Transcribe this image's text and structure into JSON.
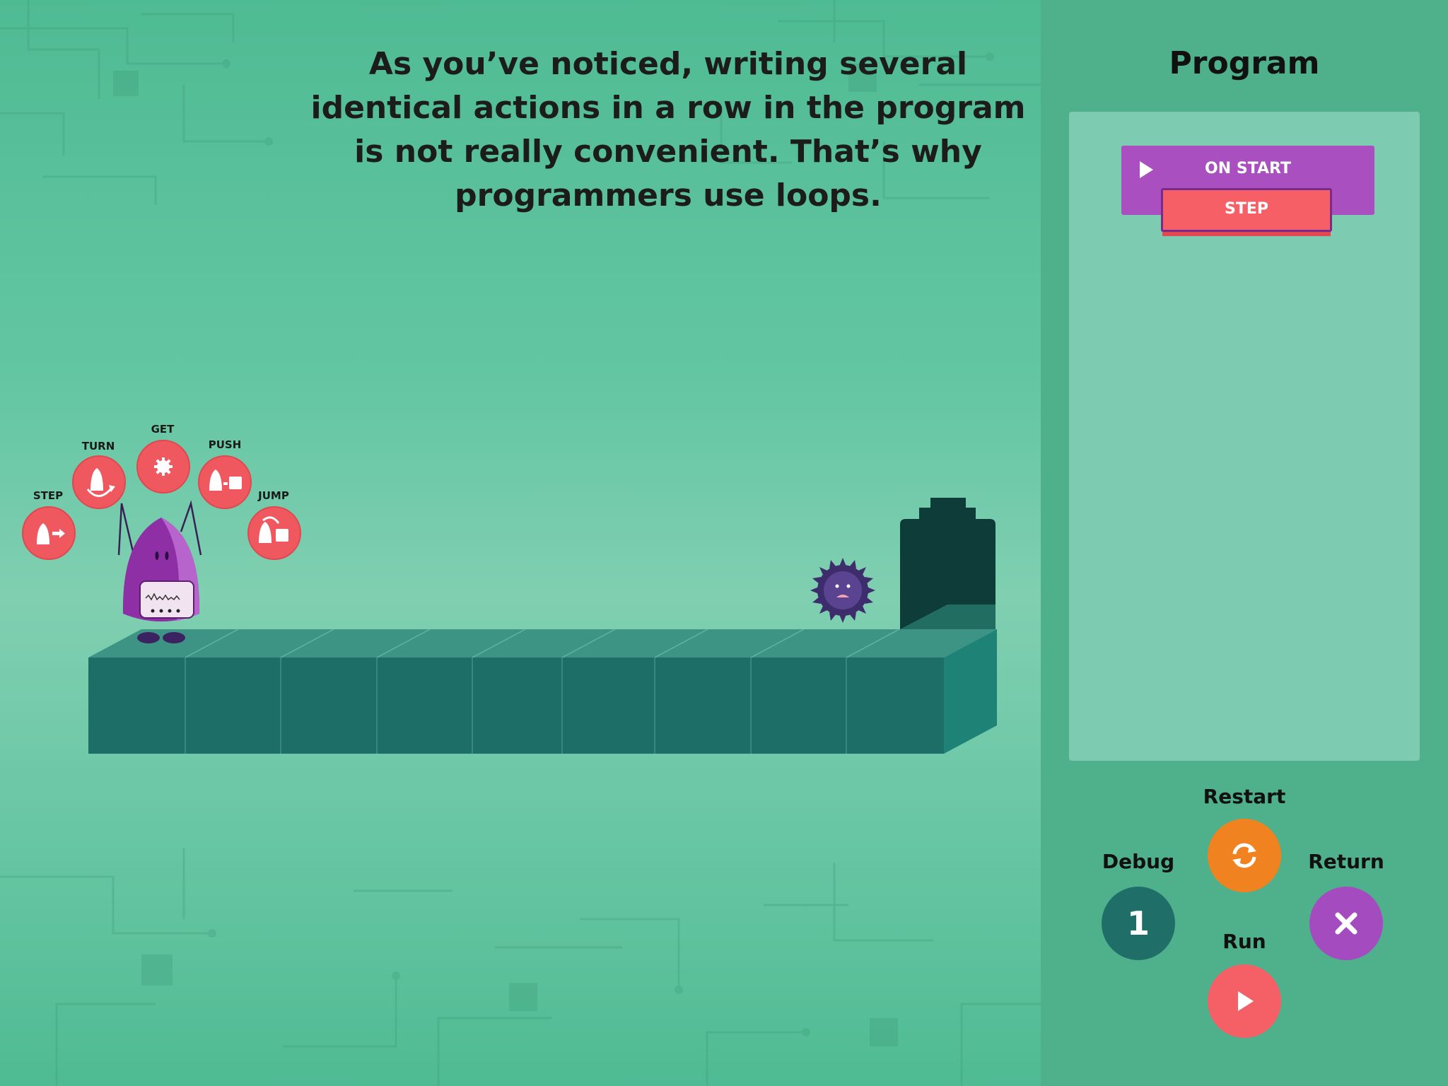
{
  "instruction": "As you’ve noticed, writing several identical actions in a row in the program is not really convenient. That’s why programmers use loops.",
  "actions": [
    {
      "label": "STEP",
      "icon": "robot-step-icon"
    },
    {
      "label": "TURN",
      "icon": "robot-turn-icon"
    },
    {
      "label": "GET",
      "icon": "gear-icon"
    },
    {
      "label": "PUSH",
      "icon": "robot-push-icon"
    },
    {
      "label": "JUMP",
      "icon": "robot-jump-icon"
    }
  ],
  "colors": {
    "stage_bg": "#63c6a3",
    "panel_bg": "#4fb08c",
    "action_red": "#f0585f",
    "block_purple": "#a94fbf",
    "block_red": "#f75f66",
    "tile_front": "#1d6e66",
    "tile_top": "#3d9484",
    "restart_orange": "#f0821f",
    "debug_teal": "#1f6e68",
    "return_purple": "#a34bbf",
    "run_red": "#f55f66"
  },
  "panel": {
    "title": "Program",
    "on_start_label": "ON START",
    "step_label": "STEP"
  },
  "controls": {
    "restart": {
      "label": "Restart",
      "icon": "refresh-icon"
    },
    "debug": {
      "label": "Debug",
      "value": "1"
    },
    "return": {
      "label": "Return",
      "icon": "close-icon"
    },
    "run": {
      "label": "Run",
      "icon": "play-icon"
    }
  },
  "level": {
    "tiles": 9,
    "character": "purple-robot",
    "enemy": "spiky-virus",
    "goal": "dark-castle-door"
  }
}
